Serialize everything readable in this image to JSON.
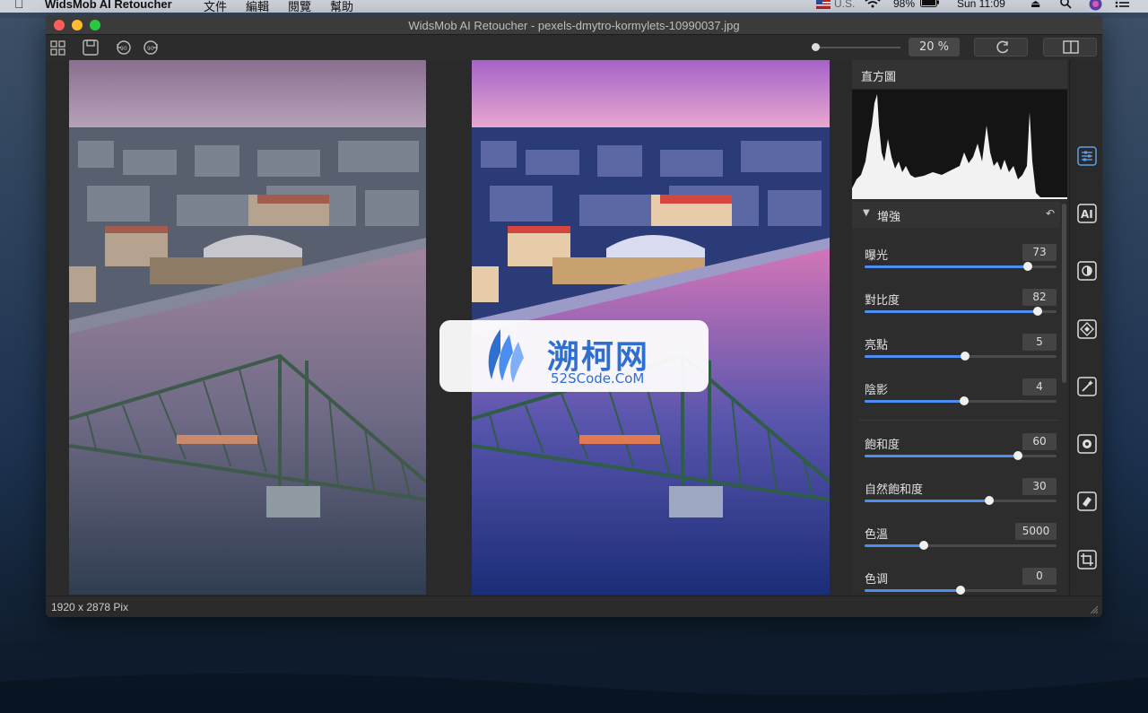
{
  "menubar": {
    "app_name": "WidsMob AI Retoucher",
    "menus": [
      "文件",
      "編輯",
      "閱覽",
      "幫助"
    ],
    "input_source": "U.S.",
    "battery": "98%",
    "clock": "Sun 11:09"
  },
  "window": {
    "title": "WidsMob AI Retoucher - pexels-dmytro-kormylets-10990037.jpg"
  },
  "toolbar": {
    "zoom": "20 %",
    "zoom_level": 0.0
  },
  "status": {
    "dimensions": "1920 x 2878 Pix"
  },
  "panel": {
    "histogram_title": "直方圖",
    "enhance_title": "增強",
    "controls": [
      {
        "label": "曝光",
        "value": "73",
        "fraction": 0.85
      },
      {
        "label": "對比度",
        "value": "82",
        "fraction": 0.9
      },
      {
        "label": "亮點",
        "value": "5",
        "fraction": 0.525
      },
      {
        "label": "陰影",
        "value": "4",
        "fraction": 0.52
      },
      {
        "label": "飽和度",
        "value": "60",
        "fraction": 0.8
      },
      {
        "label": "自然飽和度",
        "value": "30",
        "fraction": 0.65
      },
      {
        "label": "色溫",
        "value": "5000",
        "fraction": 0.31
      },
      {
        "label": "色调",
        "value": "0",
        "fraction": 0.5
      }
    ]
  },
  "watermark": {
    "cn": "溯柯网",
    "en": "52SCode.CoM"
  },
  "colors": {
    "accent": "#4b8ef0",
    "tool_icon": "#5aa0e8"
  }
}
